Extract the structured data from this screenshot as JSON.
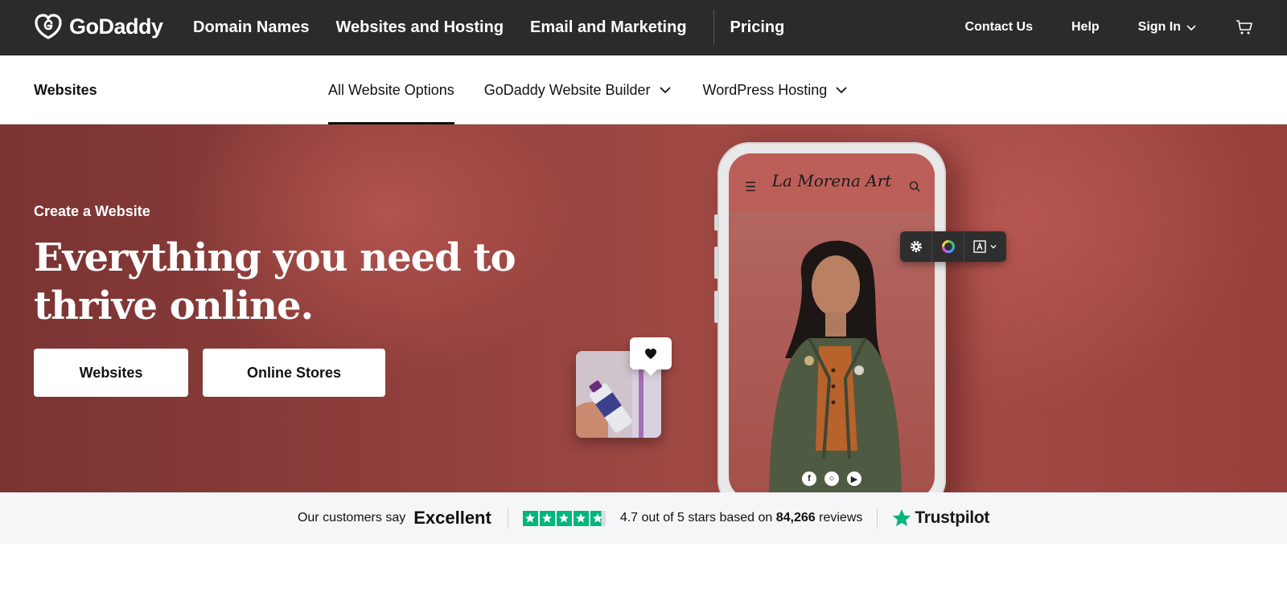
{
  "topnav": {
    "logo_text": "GoDaddy",
    "primary": [
      "Domain Names",
      "Websites and Hosting",
      "Email and Marketing",
      "Pricing"
    ],
    "contact": "Contact Us",
    "help": "Help",
    "sign_in": "Sign In"
  },
  "subnav": {
    "title": "Websites",
    "tabs": [
      {
        "label": "All Website Options",
        "active": true
      },
      {
        "label": "GoDaddy Website Builder",
        "dropdown": true
      },
      {
        "label": "WordPress Hosting",
        "dropdown": true
      }
    ]
  },
  "hero": {
    "eyebrow": "Create a Website",
    "title": "Everything you need to thrive online.",
    "buttons": {
      "websites": "Websites",
      "stores": "Online Stores"
    },
    "phone_brand": "La Morena Art"
  },
  "trust": {
    "intro": "Our customers say",
    "rating_word": "Excellent",
    "score_text": "4.7 out of 5 stars based on",
    "review_count": "84,266",
    "reviews_word": "reviews",
    "brand": "Trustpilot",
    "stars_value": 4.7,
    "stars_max": 5
  },
  "colors": {
    "topnav_bg": "#2b2b2b",
    "hero_bg": "#a14a45",
    "trustpilot_green": "#00b67a"
  },
  "icons": [
    "godaddy-logo-icon",
    "cart-icon",
    "chevron-down-icon",
    "menu-icon",
    "search-icon",
    "gear-icon",
    "color-wheel-icon",
    "text-style-icon",
    "heart-icon",
    "facebook-icon",
    "instagram-icon",
    "youtube-icon",
    "trustpilot-star-icon"
  ]
}
